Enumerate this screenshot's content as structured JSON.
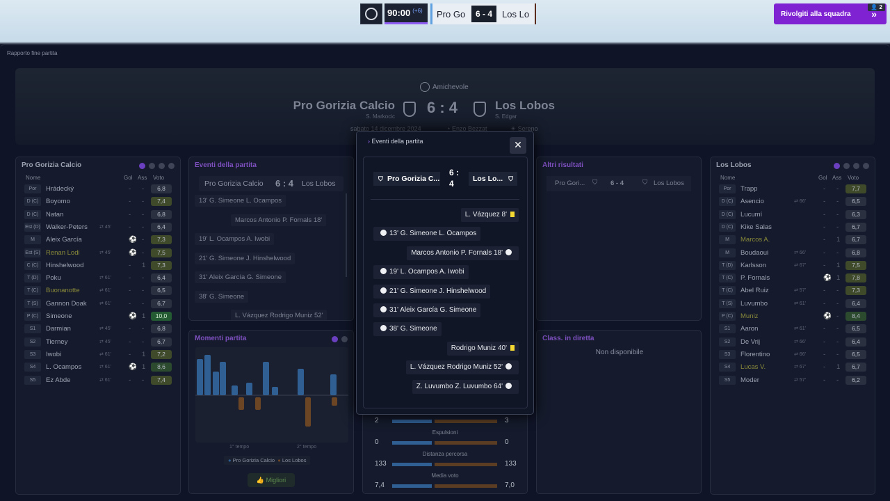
{
  "topbar": {
    "time": "90:00",
    "added": "(+6)",
    "home": "Pro Go",
    "score": "6 - 4",
    "away": "Los Lo",
    "rejoin": "Rivolgiti alla squadra",
    "rejoin_count": "2"
  },
  "report_title": "Rapporto fine partita",
  "hero": {
    "competition": "Amichevole",
    "home": "Pro Gorizia Calcio",
    "away": "Los Lobos",
    "score": "6 : 4",
    "home_coach": "S. Markocic",
    "away_coach": "S. Edgar",
    "date": "sabato 14 dicembre 2024",
    "referee": "Enzo Bezzat",
    "weather": "Sereno"
  },
  "home_panel": {
    "title": "Pro Gorizia Calcio",
    "headers": {
      "name": "Nome",
      "goals": "Gol",
      "assists": "Ass",
      "rating": "Voto"
    },
    "players": [
      {
        "pos": "Por",
        "name": "Hrádecký",
        "sub": "",
        "g": "-",
        "a": "-",
        "v": "6,8",
        "vc": ""
      },
      {
        "pos": "D (C)",
        "name": "Boyomo",
        "sub": "",
        "g": "-",
        "a": "-",
        "v": "7,4",
        "vc": "lg"
      },
      {
        "pos": "D (C)",
        "name": "Natan",
        "sub": "",
        "g": "-",
        "a": "-",
        "v": "6,8",
        "vc": ""
      },
      {
        "pos": "Est (D)",
        "name": "Walker-Peters",
        "sub": "⇄ 45'",
        "g": "-",
        "a": "-",
        "v": "6,4",
        "vc": ""
      },
      {
        "pos": "M",
        "name": "Aleix García",
        "sub": "",
        "g": "⚽",
        "a": "-",
        "v": "7,3",
        "vc": "lg"
      },
      {
        "pos": "Est (S)",
        "name": "Renan Lodi",
        "sub": "⇄ 45'",
        "g": "⚽",
        "a": "-",
        "v": "7,5",
        "vc": "lg",
        "gold": true
      },
      {
        "pos": "C (C)",
        "name": "Hinshelwood",
        "sub": "",
        "g": "-",
        "a": "1",
        "v": "7,3",
        "vc": "lg"
      },
      {
        "pos": "T (D)",
        "name": "Poku",
        "sub": "⇄ 61'",
        "g": "-",
        "a": "-",
        "v": "6,4",
        "vc": ""
      },
      {
        "pos": "T (C)",
        "name": "Buonanotte",
        "sub": "⇄ 61'",
        "g": "-",
        "a": "-",
        "v": "6,5",
        "vc": "",
        "gold": true
      },
      {
        "pos": "T (S)",
        "name": "Gannon Doak",
        "sub": "⇄ 61'",
        "g": "-",
        "a": "-",
        "v": "6,7",
        "vc": ""
      },
      {
        "pos": "P (C)",
        "name": "Simeone",
        "sub": "",
        "g": "⚽",
        "a": "1",
        "v": "10,0",
        "vc": "br"
      },
      {
        "pos": "S1",
        "name": "Darmian",
        "sub": "⇄ 45'",
        "g": "-",
        "a": "-",
        "v": "6,8",
        "vc": ""
      },
      {
        "pos": "S2",
        "name": "Tierney",
        "sub": "⇄ 45'",
        "g": "-",
        "a": "-",
        "v": "6,7",
        "vc": ""
      },
      {
        "pos": "S3",
        "name": "Iwobi",
        "sub": "⇄ 61'",
        "g": "-",
        "a": "1",
        "v": "7,2",
        "vc": "lg"
      },
      {
        "pos": "S4",
        "name": "L. Ocampos",
        "sub": "⇄ 61'",
        "g": "⚽",
        "a": "1",
        "v": "8,6",
        "vc": "dg"
      },
      {
        "pos": "S5",
        "name": "Ez Abde",
        "sub": "⇄ 61'",
        "g": "-",
        "a": "-",
        "v": "7,4",
        "vc": "lg"
      }
    ]
  },
  "events_panel": {
    "title": "Eventi della partita",
    "home": "Pro Gorizia Calcio",
    "score": "6 : 4",
    "away": "Los Lobos",
    "items": [
      "13'  G. Simeone  L. Ocampos",
      "Marcos Antonio  P. Fornals  18'",
      "19'  L. Ocampos  A. Iwobi",
      "21'  G. Simeone  J. Hinshelwood",
      "31'  Aleix García  G. Simeone",
      "38'  G. Simeone",
      "L. Vázquez  Rodrigo Muniz  52'"
    ]
  },
  "moments": {
    "title": "Momenti partita",
    "first_half": "1° tempo",
    "second_half": "2° tempo",
    "legend_home": "Pro Gorizia Calcio",
    "legend_away": "Los Lobos",
    "best_button": "Migliori",
    "chart_data": {
      "type": "bar",
      "series": [
        {
          "name": "Pro Gorizia Calcio",
          "values": [
            52,
            58,
            34,
            48,
            14,
            18,
            48,
            12,
            38,
            30
          ]
        },
        {
          "name": "Los Lobos",
          "values": [
            0,
            0,
            0,
            0,
            18,
            18,
            0,
            0,
            42,
            12
          ]
        }
      ]
    }
  },
  "modal": {
    "title": "Eventi della partita",
    "home": "Pro Gorizia C...",
    "score_top": "6 :",
    "score_bottom": "4",
    "away": "Los Lo...",
    "events": [
      {
        "text": "L. Vázquez  8'",
        "side": "away",
        "type": "yellow"
      },
      {
        "text": "13'  G. Simeone  L. Ocampos",
        "side": "home",
        "type": "goal"
      },
      {
        "text": "Marcos Antonio  P. Fornals  18'",
        "side": "away",
        "type": "goal"
      },
      {
        "text": "19'  L. Ocampos  A. Iwobi",
        "side": "home",
        "type": "goal"
      },
      {
        "text": "21'  G. Simeone  J. Hinshelwood",
        "side": "home",
        "type": "goal"
      },
      {
        "text": "31'  Aleix García  G. Simeone",
        "side": "home",
        "type": "goal"
      },
      {
        "text": "38'  G. Simeone",
        "side": "home",
        "type": "goal"
      },
      {
        "text": "Rodrigo Muniz  40'",
        "side": "away",
        "type": "yellow"
      },
      {
        "text": "L. Vázquez  Rodrigo Muniz  52'",
        "side": "away",
        "type": "goal"
      },
      {
        "text": "Z. Luvumbo  Z. Luvumbo  64'",
        "side": "away",
        "type": "goal"
      }
    ]
  },
  "stats": [
    {
      "label": "",
      "home": "2",
      "away": "3"
    },
    {
      "label": "Espulsioni",
      "home": "0",
      "away": "0"
    },
    {
      "label": "Distanza percorsa",
      "home": "133",
      "away": "133"
    },
    {
      "label": "Media voto",
      "home": "7,4",
      "away": "7,0"
    }
  ],
  "other_results": {
    "title": "Altri risultati",
    "home": "Pro Gori...",
    "score": "6 - 4",
    "away": "Los Lobos"
  },
  "live_table": {
    "title": "Class. in diretta",
    "text": "Non disponibile"
  },
  "away_panel": {
    "title": "Los Lobos",
    "headers": {
      "name": "Nome",
      "goals": "Gol",
      "assists": "Ass",
      "rating": "Voto"
    },
    "players": [
      {
        "pos": "Por",
        "name": "Trapp",
        "sub": "",
        "g": "-",
        "a": "-",
        "v": "7,7",
        "vc": "lg"
      },
      {
        "pos": "D (C)",
        "name": "Asencio",
        "sub": "⇄ 66'",
        "g": "-",
        "a": "-",
        "v": "6,5",
        "vc": ""
      },
      {
        "pos": "D (C)",
        "name": "Lucumí",
        "sub": "",
        "g": "-",
        "a": "-",
        "v": "6,3",
        "vc": ""
      },
      {
        "pos": "D (C)",
        "name": "Kike Salas",
        "sub": "",
        "g": "-",
        "a": "-",
        "v": "6,7",
        "vc": ""
      },
      {
        "pos": "M",
        "name": "Marcos A.",
        "sub": "",
        "g": "-",
        "a": "1",
        "v": "6,7",
        "vc": "",
        "gold": true
      },
      {
        "pos": "M",
        "name": "Boudaoui",
        "sub": "⇄ 66'",
        "g": "-",
        "a": "-",
        "v": "6,8",
        "vc": ""
      },
      {
        "pos": "T (D)",
        "name": "Karlsson",
        "sub": "⇄ 67'",
        "g": "-",
        "a": "1",
        "v": "7,5",
        "vc": "lg"
      },
      {
        "pos": "T (C)",
        "name": "P. Fornals",
        "sub": "",
        "g": "⚽",
        "a": "1",
        "v": "7,8",
        "vc": "lg"
      },
      {
        "pos": "T (C)",
        "name": "Abel Ruiz",
        "sub": "⇄ 57'",
        "g": "-",
        "a": "-",
        "v": "7,3",
        "vc": "lg"
      },
      {
        "pos": "T (S)",
        "name": "Luvumbo",
        "sub": "⇄ 61'",
        "g": "-",
        "a": "-",
        "v": "6,4",
        "vc": ""
      },
      {
        "pos": "P (C)",
        "name": "Muniz",
        "sub": "",
        "g": "⚽",
        "a": "-",
        "v": "8,4",
        "vc": "dg",
        "gold": true
      },
      {
        "pos": "S1",
        "name": "Aaron",
        "sub": "⇄ 61'",
        "g": "-",
        "a": "-",
        "v": "6,5",
        "vc": ""
      },
      {
        "pos": "S2",
        "name": "De Vrij",
        "sub": "⇄ 66'",
        "g": "-",
        "a": "-",
        "v": "6,4",
        "vc": ""
      },
      {
        "pos": "S3",
        "name": "Florentino",
        "sub": "⇄ 66'",
        "g": "-",
        "a": "-",
        "v": "6,5",
        "vc": ""
      },
      {
        "pos": "S4",
        "name": "Lucas V.",
        "sub": "⇄ 67'",
        "g": "-",
        "a": "1",
        "v": "6,7",
        "vc": "",
        "gold": true
      },
      {
        "pos": "S5",
        "name": "Moder",
        "sub": "⇄ 57'",
        "g": "-",
        "a": "-",
        "v": "6,2",
        "vc": ""
      }
    ]
  },
  "colors": {
    "accent": "#7f22d2",
    "home_series": "#2f5f93",
    "away_series": "#6b4524"
  }
}
